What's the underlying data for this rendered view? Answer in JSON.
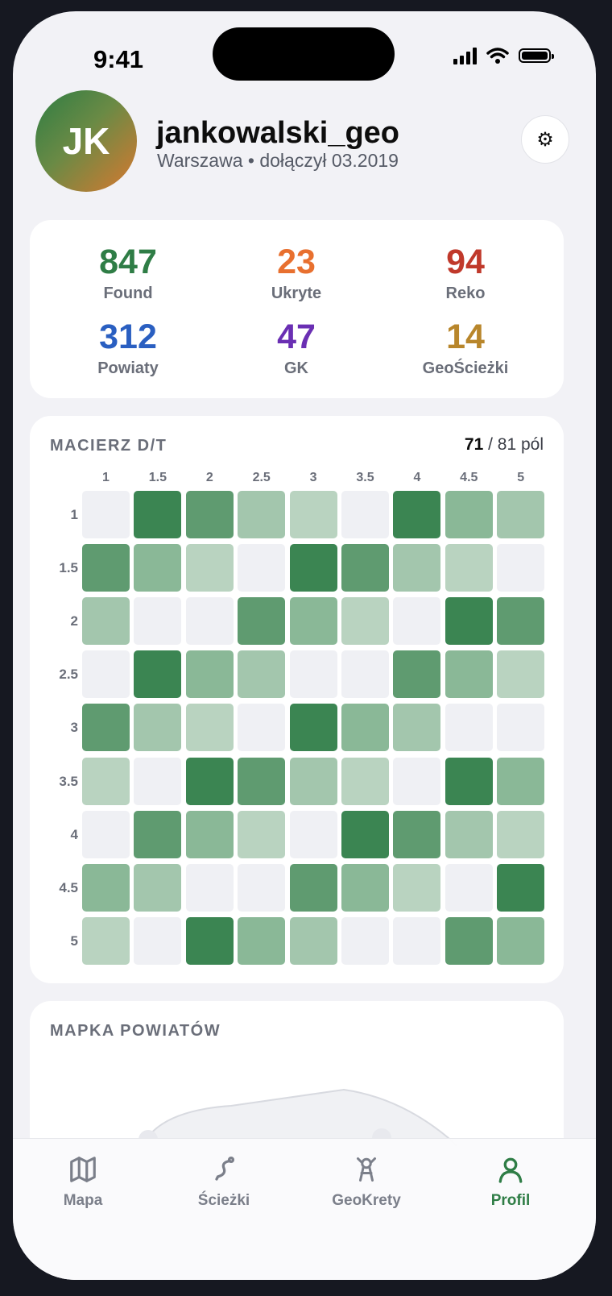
{
  "status_bar": {
    "time": "9:41"
  },
  "profile": {
    "initials": "JK",
    "username": "jankowalski_geo",
    "subline": "Warszawa • dołączył 03.2019",
    "settings_icon": "gear-icon"
  },
  "stats": [
    {
      "value": "847",
      "label": "Found",
      "color": "#2f7d46"
    },
    {
      "value": "23",
      "label": "Ukryte",
      "color": "#e8702f"
    },
    {
      "value": "94",
      "label": "Reko",
      "color": "#c0392b"
    },
    {
      "value": "312",
      "label": "Powiaty",
      "color": "#2a5fc1"
    },
    {
      "value": "47",
      "label": "GK",
      "color": "#6a2fb3"
    },
    {
      "value": "14",
      "label": "GeoŚcieżki",
      "color": "#b8862b"
    }
  ],
  "matrix": {
    "title": "MACIERZ D/T",
    "count_value": "71",
    "count_rest": " / 81 pól",
    "columns": [
      "1",
      "1.5",
      "2",
      "2.5",
      "3",
      "3.5",
      "4",
      "4.5",
      "5"
    ],
    "rows": [
      "1",
      "1.5",
      "2",
      "2.5",
      "3",
      "3.5",
      "4",
      "4.5",
      "5"
    ],
    "levels": [
      [
        0,
        5,
        4,
        2,
        1,
        0,
        5,
        3,
        2
      ],
      [
        4,
        3,
        1,
        0,
        5,
        4,
        2,
        1,
        0
      ],
      [
        2,
        0,
        0,
        4,
        3,
        1,
        0,
        5,
        4
      ],
      [
        0,
        5,
        3,
        2,
        0,
        0,
        4,
        3,
        1
      ],
      [
        4,
        2,
        1,
        0,
        5,
        3,
        2,
        0,
        0
      ],
      [
        1,
        0,
        5,
        4,
        2,
        1,
        0,
        5,
        3
      ],
      [
        0,
        4,
        3,
        1,
        0,
        5,
        4,
        2,
        1
      ],
      [
        3,
        2,
        0,
        0,
        4,
        3,
        1,
        0,
        5
      ],
      [
        1,
        0,
        5,
        3,
        2,
        0,
        0,
        4,
        3
      ]
    ],
    "palette": [
      "#eff0f4",
      "#b9d3c0",
      "#a3c6ad",
      "#8ab897",
      "#5f9b70",
      "#3b8552"
    ]
  },
  "map": {
    "title": "MAPKA POWIATÓW"
  },
  "tabs": [
    {
      "label": "Mapa",
      "icon": "map-icon",
      "active": false
    },
    {
      "label": "Ścieżki",
      "icon": "path-icon",
      "active": false
    },
    {
      "label": "GeoKrety",
      "icon": "geokret-icon",
      "active": false
    },
    {
      "label": "Profil",
      "icon": "profile-icon",
      "active": true
    }
  ],
  "colors": {
    "accent": "#2f7d46",
    "inactive": "#7b7f8a"
  }
}
